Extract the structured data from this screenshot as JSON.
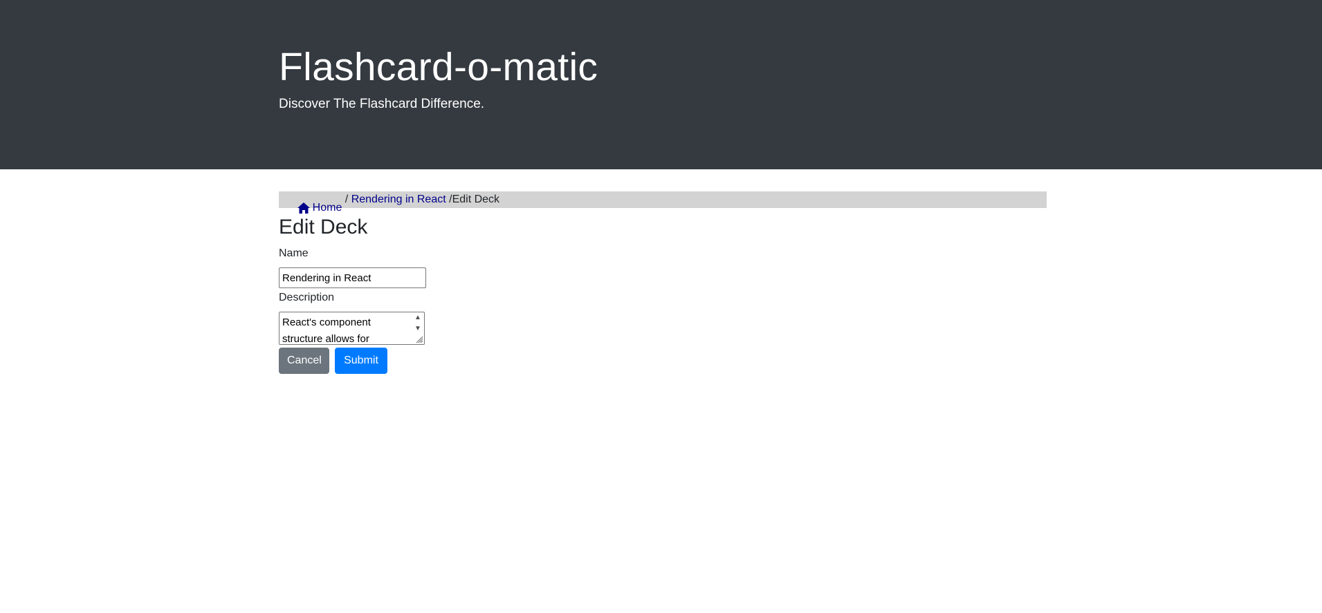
{
  "header": {
    "title": "Flashcard-o-matic",
    "tagline": "Discover The Flashcard Difference."
  },
  "breadcrumb": {
    "home_label": "Home",
    "separator1": " / ",
    "deck_label": "Rendering in React",
    "separator2": " /",
    "current_label": "Edit Deck"
  },
  "page": {
    "title": "Edit Deck"
  },
  "form": {
    "name_label": "Name",
    "name_value": "Rendering in React",
    "description_label": "Description",
    "description_value": "React's component structure allows for",
    "cancel_label": "Cancel",
    "submit_label": "Submit"
  },
  "colors": {
    "header_bg": "#343a40",
    "breadcrumb_bg": "#d3d3d3",
    "link": "#00008b",
    "cancel_bg": "#6c757d",
    "submit_bg": "#007bff"
  },
  "icons": {
    "home": "home-icon"
  }
}
